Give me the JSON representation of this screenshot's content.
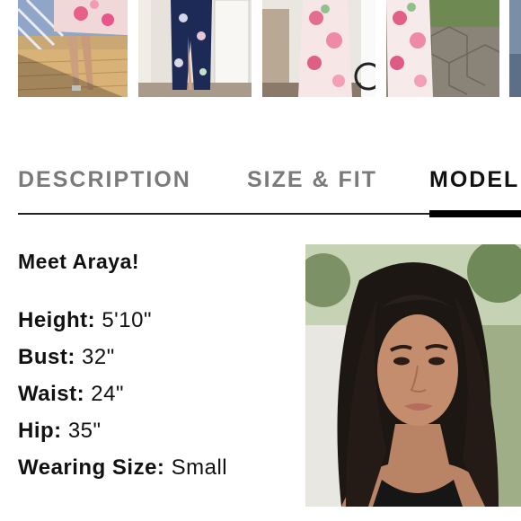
{
  "gallery": {
    "thumbnails": [
      {
        "name": "thumbnail-1"
      },
      {
        "name": "thumbnail-2"
      },
      {
        "name": "thumbnail-3"
      },
      {
        "name": "thumbnail-4"
      },
      {
        "name": "thumbnail-5"
      }
    ]
  },
  "tabs": {
    "items": [
      {
        "label": "DESCRIPTION",
        "active": false
      },
      {
        "label": "SIZE & FIT",
        "active": false
      },
      {
        "label": "MODEL",
        "active": true
      }
    ]
  },
  "model": {
    "intro": "Meet Araya!",
    "stats": [
      {
        "label": "Height:",
        "value": "5'10\""
      },
      {
        "label": "Bust:",
        "value": "32\""
      },
      {
        "label": "Waist:",
        "value": "24\""
      },
      {
        "label": "Hip:",
        "value": "35\""
      },
      {
        "label": "Wearing Size:",
        "value": "Small"
      }
    ]
  },
  "colors": {
    "active_tab": "#111111",
    "inactive_tab": "#7a7a7a",
    "divider": "#222222",
    "active_indicator": "#000000"
  }
}
